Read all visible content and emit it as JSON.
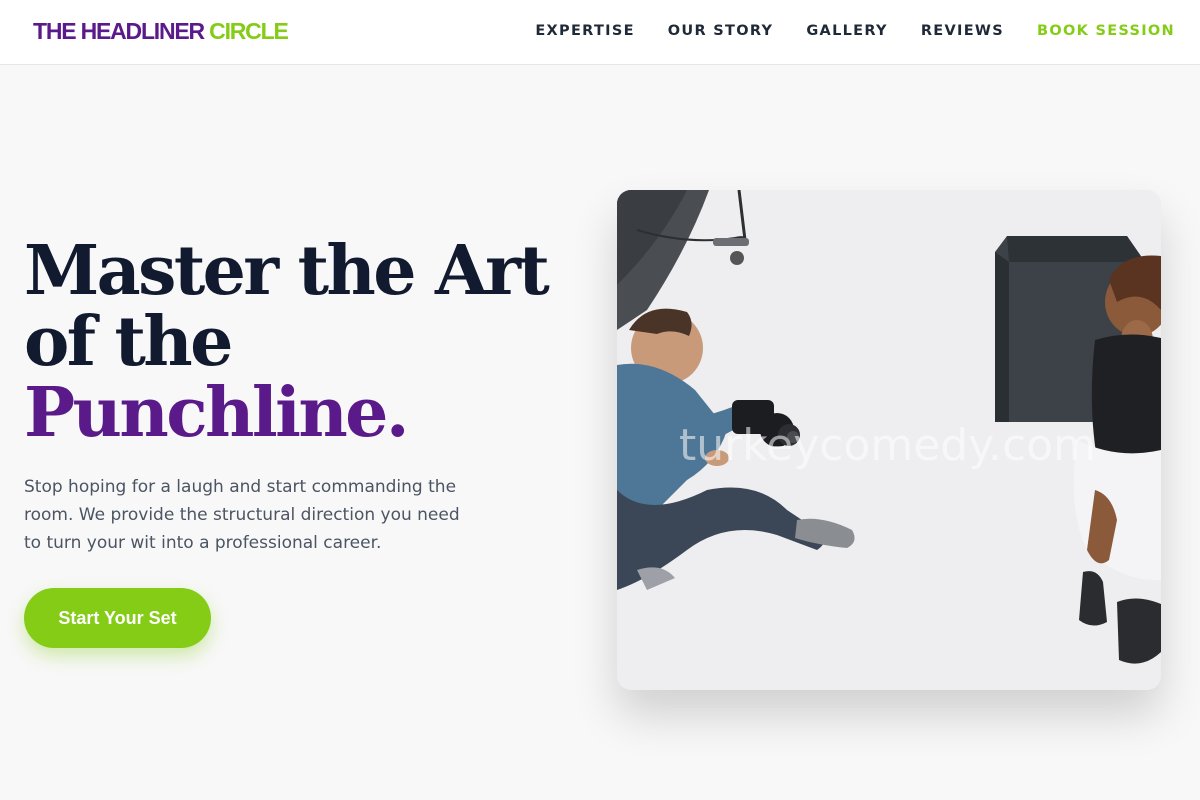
{
  "brand": {
    "logo_part1": "THE HEADLINER",
    "logo_part2": "CIRCLE",
    "primary_color": "#5b1a8a",
    "accent_color": "#84cc16"
  },
  "nav": {
    "items": [
      {
        "label": "EXPERTISE"
      },
      {
        "label": "OUR STORY"
      },
      {
        "label": "GALLERY"
      },
      {
        "label": "REVIEWS"
      },
      {
        "label": "BOOK SESSION"
      }
    ]
  },
  "hero": {
    "title_line1": "Master the Art",
    "title_line2": "of the",
    "title_accent": "Punchline.",
    "subtitle": "Stop hoping for a laugh and start commanding the room. We provide the structural direction you need to turn your wit into a professional career.",
    "cta_label": "Start Your Set"
  },
  "photo": {
    "watermark": "turkeycomedy.com"
  }
}
